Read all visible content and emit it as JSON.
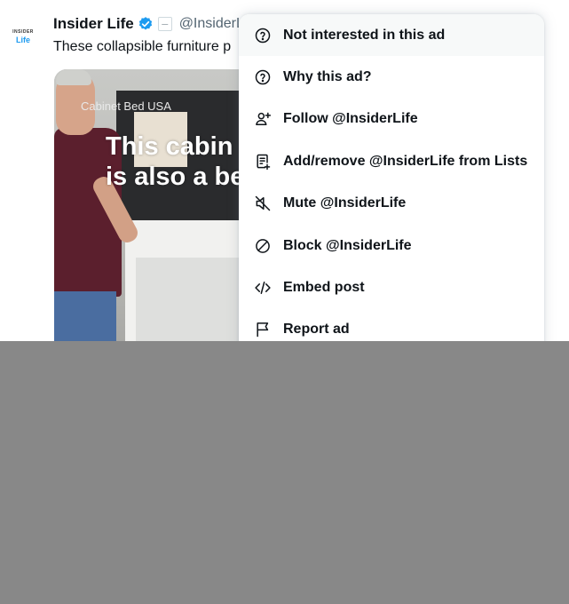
{
  "tweet": {
    "avatar_line1": "INSIDER",
    "avatar_line2": "Life",
    "name": "Insider Life",
    "handle": "@InsiderL",
    "text": "These collapsible furniture p",
    "affiliate_badge": "—"
  },
  "media": {
    "brand": "Cabinet Bed USA",
    "caption": "This cabin\nis also a be"
  },
  "menu": {
    "items": [
      {
        "label": "Not interested in this ad",
        "icon": "question-circle-icon"
      },
      {
        "label": "Why this ad?",
        "icon": "question-circle-icon"
      },
      {
        "label": "Follow @InsiderLife",
        "icon": "follow-user-icon"
      },
      {
        "label": "Add/remove @InsiderLife from Lists",
        "icon": "list-add-icon"
      },
      {
        "label": "Mute @InsiderLife",
        "icon": "mute-icon"
      },
      {
        "label": "Block @InsiderLife",
        "icon": "block-icon"
      },
      {
        "label": "Embed post",
        "icon": "code-icon"
      },
      {
        "label": "Report ad",
        "icon": "flag-icon"
      }
    ]
  },
  "colors": {
    "accent": "#1d9bf0",
    "text": "#0f1419",
    "muted": "#536471",
    "overlay": "#888888"
  }
}
